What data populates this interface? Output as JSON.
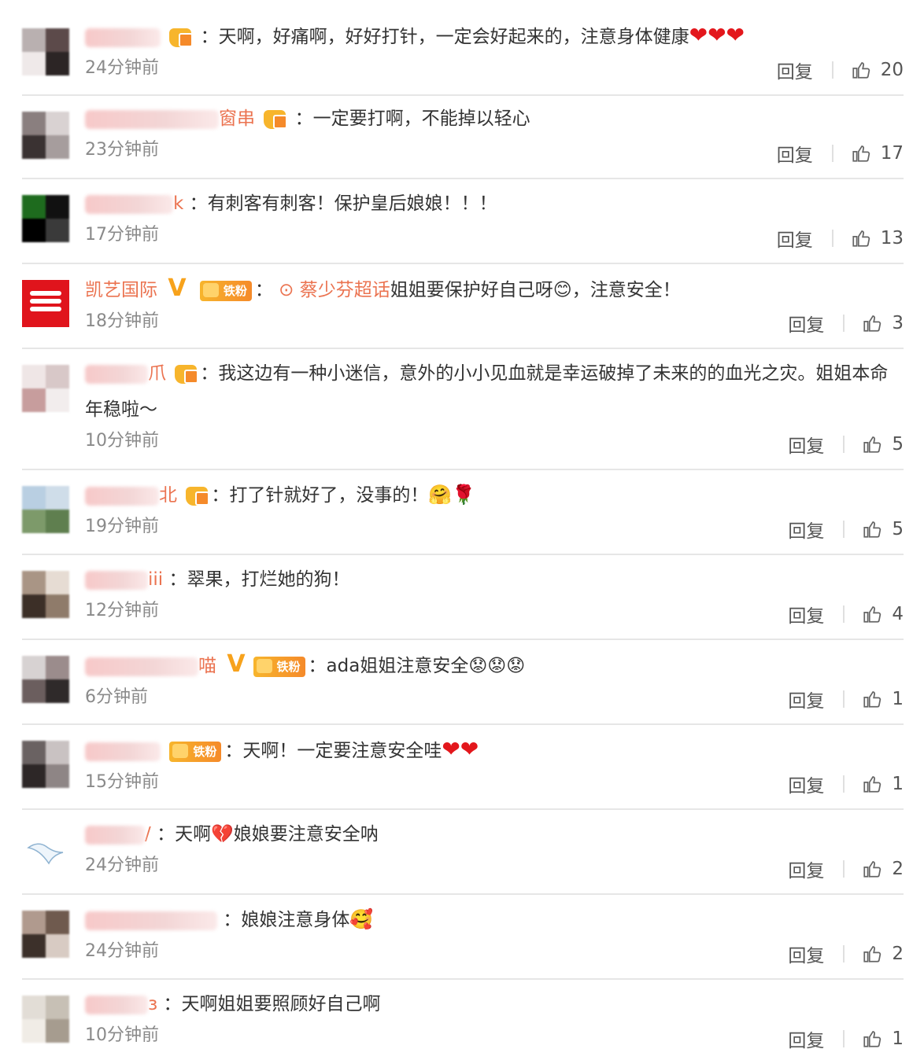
{
  "actions": {
    "reply_label": "回复"
  },
  "comments": [
    {
      "name_tail": "",
      "text": "：天啊，好痛啊，好好打针，一定会好起来的，注意身体健康",
      "hearts": "❤❤❤",
      "time": "24分钟前",
      "likes": "20"
    },
    {
      "name_tail": "窗串",
      "text": "：一定要打啊，不能掉以轻心",
      "time": "23分钟前",
      "likes": "17"
    },
    {
      "name_tail": "k",
      "text": "：有刺客有刺客！保护皇后娘娘！！！",
      "time": "17分钟前",
      "likes": "13"
    },
    {
      "name_tail": "凯艺国际",
      "verified": "V",
      "fan_label": "铁粉",
      "link": "蔡少芬超话",
      "text": "姐姐要保护好自己呀😊，注意安全！",
      "time": "18分钟前",
      "likes": "3"
    },
    {
      "name_tail": "爪",
      "text": "：我这边有一种小迷信，意外的小小见血就是幸运破掉了未来的的血光之灾。姐姐本命年稳啦～",
      "time": "10分钟前",
      "likes": "5"
    },
    {
      "name_tail": "北",
      "text": "：打了针就好了，没事的！",
      "emoji": "🤗🌹",
      "time": "19分钟前",
      "likes": "5"
    },
    {
      "name_tail": "iii",
      "text": "：翠果，打烂她的狗！",
      "time": "12分钟前",
      "likes": "4"
    },
    {
      "name_tail": "喵",
      "verified": "V",
      "fan_label": "铁粉",
      "text": "：ada姐姐注意安全😟😟😟",
      "time": "6分钟前",
      "likes": "1"
    },
    {
      "name_tail": "",
      "fan_label": "铁粉",
      "text": "：天啊！一定要注意安全哇",
      "hearts": "❤❤",
      "time": "15分钟前",
      "likes": "1"
    },
    {
      "name_tail": "/",
      "text": "：天啊💔娘娘要注意安全呐",
      "time": "24分钟前",
      "likes": "2"
    },
    {
      "name_tail": "",
      "text": "：娘娘注意身体",
      "emoji": "🥰",
      "time": "24分钟前",
      "likes": "2"
    },
    {
      "name_tail": "з",
      "text": "：天啊姐姐要照顾好自己啊",
      "time": "10分钟前",
      "likes": "1"
    }
  ]
}
